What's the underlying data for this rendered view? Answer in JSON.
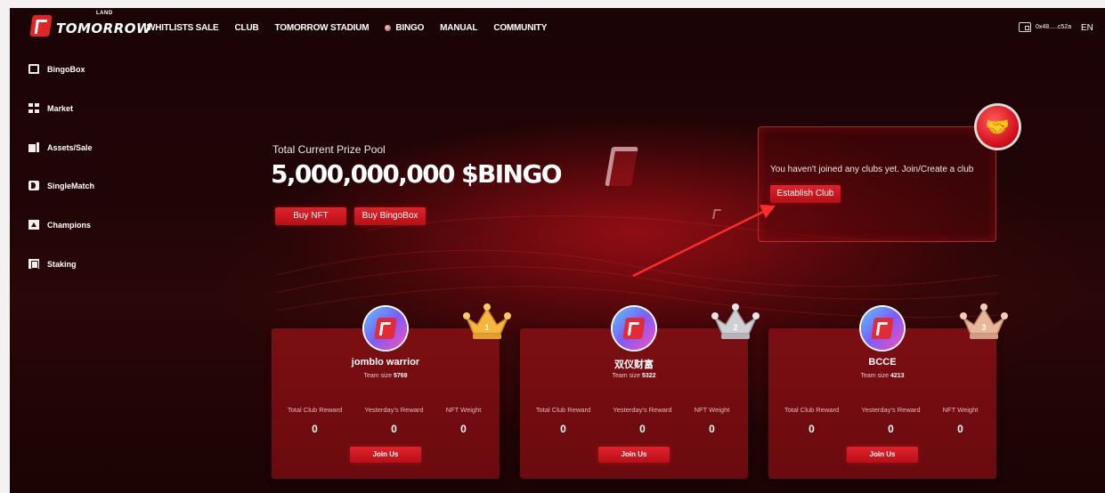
{
  "header": {
    "logo_text": "TOMORROW",
    "logo_superscript": "LAND",
    "nav": [
      "WHITLISTS SALE",
      "CLUB",
      "TOMORROW STADIUM",
      "BINGO",
      "MANUAL",
      "COMMUNITY"
    ],
    "wallet_address": "0x48.....c52a",
    "language": "EN"
  },
  "sidebar": {
    "items": [
      {
        "label": "BingoBox",
        "icon": "box-icon"
      },
      {
        "label": "Market",
        "icon": "grid-icon"
      },
      {
        "label": "Assets/Sale",
        "icon": "assets-icon"
      },
      {
        "label": "SingleMatch",
        "icon": "match-icon"
      },
      {
        "label": "Champions",
        "icon": "champion-icon"
      },
      {
        "label": "Staking",
        "icon": "staking-icon"
      }
    ]
  },
  "hero": {
    "label": "Total Current Prize Pool",
    "value": "5,000,000,000 $BINGO",
    "buy_nft": "Buy NFT",
    "buy_box": "Buy BingoBox"
  },
  "club_panel": {
    "message": "You haven't joined any clubs yet. Join/Create a club",
    "establish_label": "Establish Club",
    "badge_icon": "handshake-icon"
  },
  "cards": [
    {
      "name": "jomblo warrior",
      "team_label": "Team size",
      "team_size": "5769",
      "crown": "gold",
      "rank": "1",
      "stats": [
        {
          "label": "Total Club Reward",
          "value": "0"
        },
        {
          "label": "Yesterday's Reward",
          "value": "0"
        },
        {
          "label": "NFT Weight",
          "value": "0"
        }
      ],
      "join_label": "Join Us"
    },
    {
      "name": "双仪财富",
      "team_label": "Team size",
      "team_size": "5322",
      "crown": "silver",
      "rank": "2",
      "stats": [
        {
          "label": "Total Club Reward",
          "value": "0"
        },
        {
          "label": "Yesterday's Reward",
          "value": "0"
        },
        {
          "label": "NFT Weight",
          "value": "0"
        }
      ],
      "join_label": "Join Us"
    },
    {
      "name": "BCCE",
      "team_label": "Team size",
      "team_size": "4213",
      "crown": "bronze",
      "rank": "3",
      "stats": [
        {
          "label": "Total Club Reward",
          "value": "0"
        },
        {
          "label": "Yesterday's Reward",
          "value": "0"
        },
        {
          "label": "NFT Weight",
          "value": "0"
        }
      ],
      "join_label": "Join Us"
    }
  ],
  "colors": {
    "accent": "#e0232b",
    "background": "#210506",
    "card": "#7c0e12",
    "gold": "#f4b63c",
    "silver": "#cfcfd4",
    "bronze": "#e8b79a"
  }
}
